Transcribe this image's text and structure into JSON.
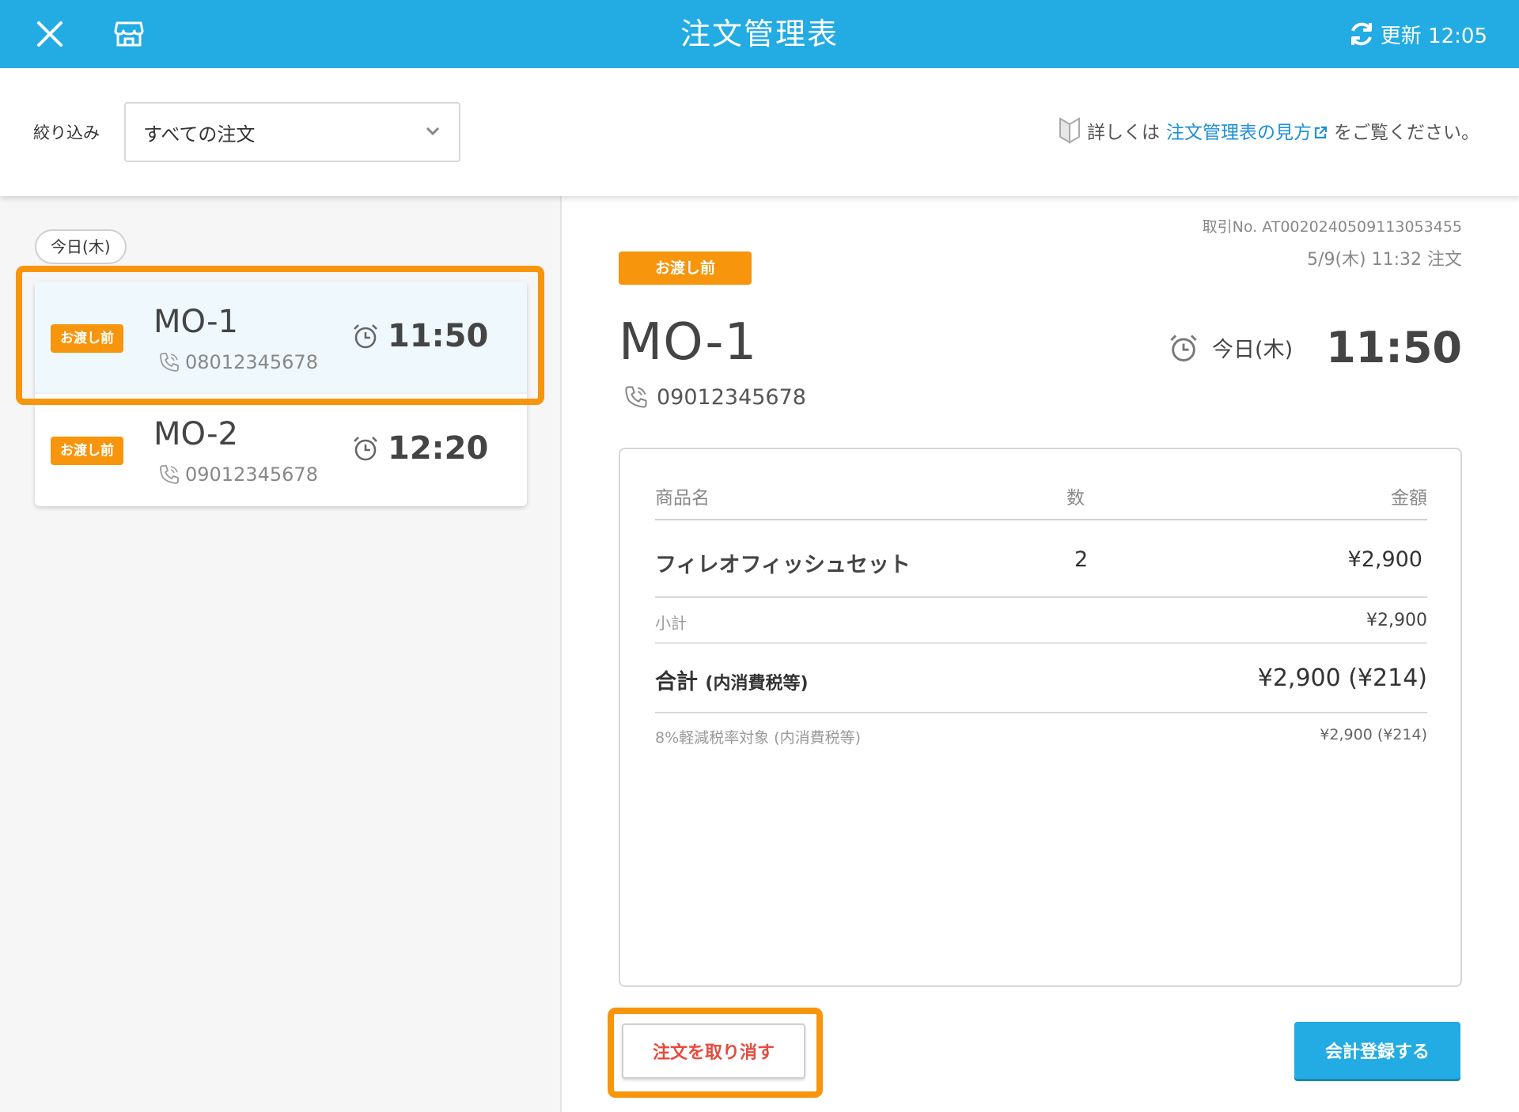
{
  "header": {
    "title": "注文管理表",
    "refresh_label": "更新 12:05"
  },
  "filter": {
    "label": "絞り込み",
    "selected": "すべての注文",
    "info_prefix": "詳しくは",
    "info_link": "注文管理表の見方",
    "info_suffix": "をご覧ください。"
  },
  "list": {
    "date_label": "今日(木)",
    "orders": [
      {
        "status": "お渡し前",
        "name": "MO-1",
        "phone": "08012345678",
        "time": "11:50"
      },
      {
        "status": "お渡し前",
        "name": "MO-2",
        "phone": "09012345678",
        "time": "12:20"
      }
    ]
  },
  "detail": {
    "transaction_no": "取引No. AT0020240509113053455",
    "order_datetime": "5/9(木)  11:32  注文",
    "status": "お渡し前",
    "name": "MO-1",
    "phone": "09012345678",
    "due_day": "今日(木)",
    "due_time": "11:50",
    "columns": {
      "product": "商品名",
      "qty": "数",
      "amount": "金額"
    },
    "items": [
      {
        "name": "フィレオフィッシュセット",
        "qty": "2",
        "amount": "¥2,900"
      }
    ],
    "subtotal_label": "小計",
    "subtotal_value": "¥2,900",
    "total_label": "合計",
    "total_sub_label": "(内消費税等)",
    "total_value": "¥2,900 (¥214)",
    "tax_label": "8%軽減税率対象 (内消費税等)",
    "tax_value": "¥2,900 (¥214)",
    "cancel_label": "注文を取り消す",
    "register_label": "会計登録する"
  },
  "colors": {
    "header": "#23abe3",
    "badge": "#f7950d",
    "highlight": "#f7950d",
    "link": "#1f8fd6",
    "cancel_text": "#e84a3c"
  }
}
